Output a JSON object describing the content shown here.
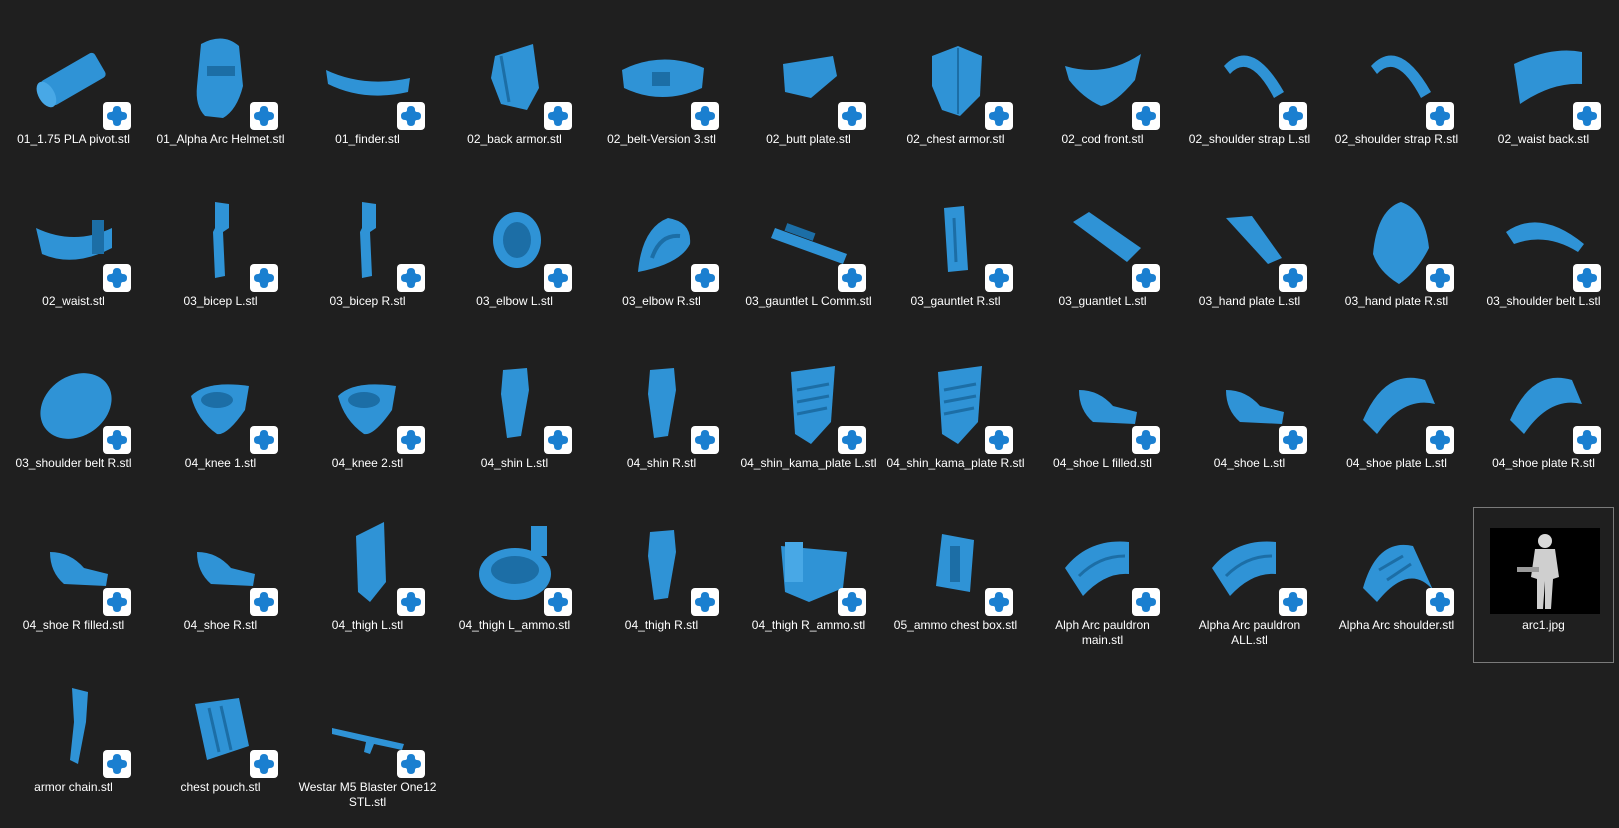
{
  "colors": {
    "background": "#1f1f1f",
    "model": "#2f93d6",
    "badge": "#ffffff",
    "badge_icon": "#1a7fd0"
  },
  "files": [
    {
      "name": "01_1.75 PLA pivot.stl",
      "icon": "cylinder-model-icon"
    },
    {
      "name": "01_Alpha Arc Helmet.stl",
      "icon": "helmet-model-icon"
    },
    {
      "name": "01_finder.stl",
      "icon": "visor-model-icon"
    },
    {
      "name": "02_back armor.stl",
      "icon": "back-armor-model-icon"
    },
    {
      "name": "02_belt-Version 3.stl",
      "icon": "belt-model-icon"
    },
    {
      "name": "02_butt plate.stl",
      "icon": "butt-plate-model-icon"
    },
    {
      "name": "02_chest armor.stl",
      "icon": "chest-armor-model-icon"
    },
    {
      "name": "02_cod front.stl",
      "icon": "cod-model-icon"
    },
    {
      "name": "02_shoulder strap L.stl",
      "icon": "strap-model-icon"
    },
    {
      "name": "02_shoulder strap R.stl",
      "icon": "strap-model-icon"
    },
    {
      "name": "02_waist back.stl",
      "icon": "waist-back-model-icon"
    },
    {
      "name": "02_waist.stl",
      "icon": "waist-model-icon"
    },
    {
      "name": "03_bicep L.stl",
      "icon": "bicep-model-icon"
    },
    {
      "name": "03_bicep R.stl",
      "icon": "bicep-model-icon"
    },
    {
      "name": "03_elbow L.stl",
      "icon": "ring-model-icon"
    },
    {
      "name": "03_elbow R.stl",
      "icon": "elbow-model-icon"
    },
    {
      "name": "03_gauntlet L Comm.stl",
      "icon": "gauntlet-comm-model-icon"
    },
    {
      "name": "03_gauntlet R.stl",
      "icon": "gauntlet-model-icon"
    },
    {
      "name": "03_guantlet L.stl",
      "icon": "cone-model-icon"
    },
    {
      "name": "03_hand plate L.stl",
      "icon": "hand-plate-model-icon"
    },
    {
      "name": "03_hand plate R.stl",
      "icon": "dome-model-icon"
    },
    {
      "name": "03_shoulder belt L.stl",
      "icon": "shell-model-icon"
    },
    {
      "name": "03_shoulder belt R.stl",
      "icon": "egg-model-icon"
    },
    {
      "name": "04_knee 1.stl",
      "icon": "knee-model-icon"
    },
    {
      "name": "04_knee 2.stl",
      "icon": "knee-model-icon"
    },
    {
      "name": "04_shin L.stl",
      "icon": "shin-model-icon"
    },
    {
      "name": "04_shin R.stl",
      "icon": "shin-model-icon"
    },
    {
      "name": "04_shin_kama_plate L.stl",
      "icon": "kama-model-icon"
    },
    {
      "name": "04_shin_kama_plate R.stl",
      "icon": "kama-model-icon"
    },
    {
      "name": "04_shoe L filled.stl",
      "icon": "shoe-model-icon"
    },
    {
      "name": "04_shoe L.stl",
      "icon": "shoe-model-icon"
    },
    {
      "name": "04_shoe plate L.stl",
      "icon": "arch-model-icon"
    },
    {
      "name": "04_shoe plate R.stl",
      "icon": "arch-model-icon"
    },
    {
      "name": "04_shoe R filled.stl",
      "icon": "shoe-model-icon"
    },
    {
      "name": "04_shoe R.stl",
      "icon": "shoe-model-icon"
    },
    {
      "name": "04_thigh L.stl",
      "icon": "thigh-model-icon"
    },
    {
      "name": "04_thigh L_ammo.stl",
      "icon": "thigh-ring-model-icon"
    },
    {
      "name": "04_thigh R.stl",
      "icon": "shin-model-icon"
    },
    {
      "name": "04_thigh R_ammo.stl",
      "icon": "thigh-ammo-model-icon"
    },
    {
      "name": "05_ammo chest box.stl",
      "icon": "box-model-icon"
    },
    {
      "name": "Alph Arc pauldron main.stl",
      "icon": "pauldron-model-icon"
    },
    {
      "name": "Alpha Arc pauldron ALL.stl",
      "icon": "pauldron-model-icon"
    },
    {
      "name": "Alpha Arc shoulder.stl",
      "icon": "shoulder-model-icon"
    },
    {
      "name": "arc1.jpg",
      "icon": "photo-thumbnail",
      "selected": true
    },
    {
      "name": "armor chain.stl",
      "icon": "chain-model-icon"
    },
    {
      "name": "chest pouch.stl",
      "icon": "pouch-model-icon"
    },
    {
      "name": "Westar M5 Blaster One12 STL.stl",
      "icon": "blaster-model-icon"
    }
  ]
}
